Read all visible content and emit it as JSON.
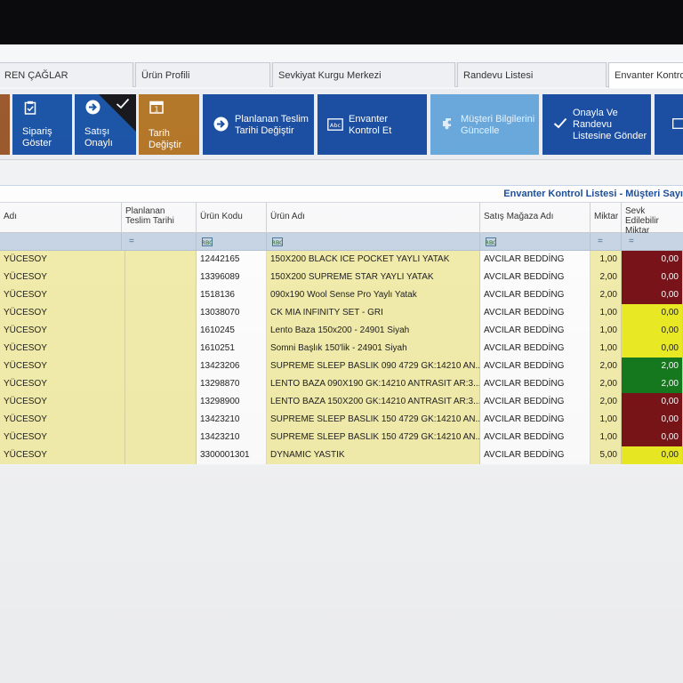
{
  "tabs": [
    {
      "label": "REN ÇAĞLAR"
    },
    {
      "label": "Ürün Profili"
    },
    {
      "label": "Sevkiyat Kurgu Merkezi"
    },
    {
      "label": "Randevu Listesi"
    },
    {
      "label": "Envanter Kontrol"
    }
  ],
  "ribbon": {
    "siparis": {
      "line1": "Sipariş",
      "line2": "Göster"
    },
    "satisi": {
      "line1": "Satışı",
      "line2": "Onaylı"
    },
    "tarih": {
      "line1": "Tarih",
      "line2": "Değiştir"
    },
    "planlanan": {
      "line1": "Planlanan Teslim",
      "line2": "Tarihi Değiştir"
    },
    "envanter": {
      "line1": "Envanter",
      "line2": "Kontrol Et"
    },
    "musteri": {
      "line1": "Müşteri Bilgilerini",
      "line2": "Güncelle"
    },
    "onayla": {
      "line1": "Onayla Ve",
      "line2": "Randevu",
      "line3": "Listesine Gönder"
    }
  },
  "grid": {
    "title": "Envanter Kontrol Listesi - Müşteri Sayı",
    "headers": {
      "adi": "Adı",
      "planlanan": "Planlanan Teslim Tarihi",
      "kod": "Ürün Kodu",
      "urun": "Ürün Adı",
      "magaza": "Satış Mağaza Adı",
      "miktar": "Miktar",
      "sevk": "Sevk Edilebilir Miktar"
    },
    "filter_eq": "=",
    "filter_rbc": "RBC",
    "rows": [
      {
        "name": "YÜCESOY",
        "date": "",
        "code": "12442165",
        "product": "150X200 BLACK ICE POCKET YAYLI YATAK",
        "store": "AVCILAR BEDDİNG",
        "qty": "1,00",
        "sevk": "0,00",
        "status": "red"
      },
      {
        "name": "YÜCESOY",
        "date": "",
        "code": "13396089",
        "product": "150X200 SUPREME STAR YAYLI YATAK",
        "store": "AVCILAR BEDDİNG",
        "qty": "2,00",
        "sevk": "0,00",
        "status": "red"
      },
      {
        "name": "YÜCESOY",
        "date": "",
        "code": "1518136",
        "product": "090x190 Wool Sense Pro Yaylı Yatak",
        "store": "AVCILAR BEDDİNG",
        "qty": "2,00",
        "sevk": "0,00",
        "status": "red"
      },
      {
        "name": "YÜCESOY",
        "date": "",
        "code": "13038070",
        "product": "CK MIA INFINITY SET - GRI",
        "store": "AVCILAR BEDDİNG",
        "qty": "1,00",
        "sevk": "0,00",
        "status": "yellow"
      },
      {
        "name": "YÜCESOY",
        "date": "",
        "code": "1610245",
        "product": "Lento Baza 150x200 - 24901 Siyah",
        "store": "AVCILAR BEDDİNG",
        "qty": "1,00",
        "sevk": "0,00",
        "status": "yellow"
      },
      {
        "name": "YÜCESOY",
        "date": "",
        "code": "1610251",
        "product": "Somni Başlık 150'lik - 24901 Siyah",
        "store": "AVCILAR BEDDİNG",
        "qty": "1,00",
        "sevk": "0,00",
        "status": "yellow"
      },
      {
        "name": "YÜCESOY",
        "date": "",
        "code": "13423206",
        "product": "SUPREME SLEEP BASLIK 090  4729 GK:14210 AN...",
        "store": "AVCILAR BEDDİNG",
        "qty": "2,00",
        "sevk": "2,00",
        "status": "green"
      },
      {
        "name": "YÜCESOY",
        "date": "",
        "code": "13298870",
        "product": "LENTO BAZA 090X190 GK:14210 ANTRASIT AR:3...",
        "store": "AVCILAR BEDDİNG",
        "qty": "2,00",
        "sevk": "2,00",
        "status": "green"
      },
      {
        "name": "YÜCESOY",
        "date": "",
        "code": "13298900",
        "product": "LENTO BAZA 150X200 GK:14210 ANTRASIT AR:3...",
        "store": "AVCILAR BEDDİNG",
        "qty": "2,00",
        "sevk": "0,00",
        "status": "red"
      },
      {
        "name": "YÜCESOY",
        "date": "",
        "code": "13423210",
        "product": "SUPREME SLEEP BASLIK 150  4729 GK:14210 AN...",
        "store": "AVCILAR BEDDİNG",
        "qty": "1,00",
        "sevk": "0,00",
        "status": "red"
      },
      {
        "name": "YÜCESOY",
        "date": "",
        "code": "13423210",
        "product": "SUPREME SLEEP BASLIK 150  4729 GK:14210 AN...",
        "store": "AVCILAR BEDDİNG",
        "qty": "1,00",
        "sevk": "0,00",
        "status": "red"
      },
      {
        "name": "YÜCESOY",
        "date": "",
        "code": "3300001301",
        "product": "DYNAMIC YASTIK",
        "store": "AVCILAR BEDDİNG",
        "qty": "5,00",
        "sevk": "0,00",
        "status": "yellow"
      }
    ]
  },
  "colors": {
    "ribbon_blue": "#1d55a8",
    "ribbon_orange": "#b5782a",
    "ribbon_light": "#6aa9dc",
    "status_red": "#7a1419",
    "status_yellow": "#ecec24",
    "status_green": "#157a1e",
    "row_yellow": "#f4eead",
    "title_blue": "#1e4f9a"
  }
}
